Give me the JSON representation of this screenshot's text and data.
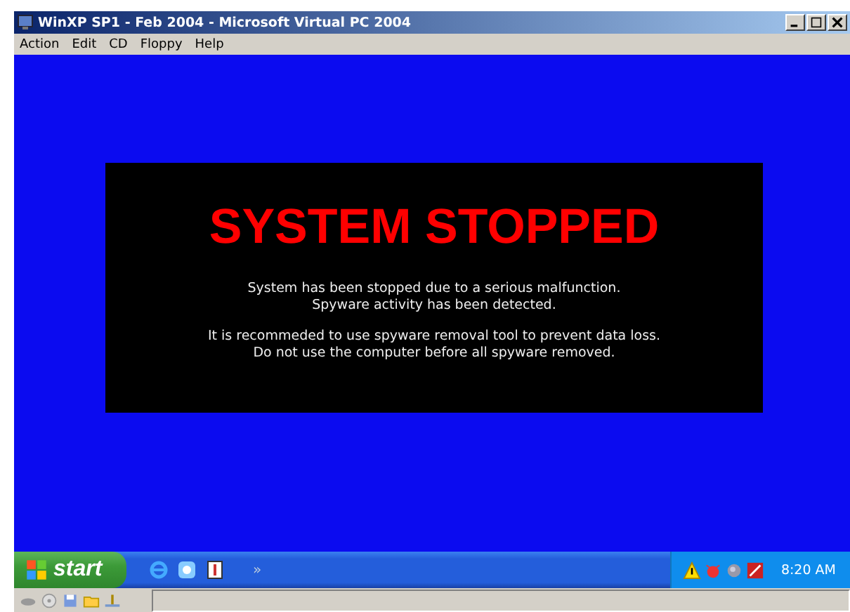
{
  "window": {
    "title": "WinXP SP1 - Feb 2004 - Microsoft Virtual PC 2004"
  },
  "menu": [
    "Action",
    "Edit",
    "CD",
    "Floppy",
    "Help"
  ],
  "alert": {
    "heading": "SYSTEM STOPPED",
    "paragraphs": [
      [
        "System has been stopped due to a serious malfunction.",
        "Spyware activity has been detected."
      ],
      [
        "It is recommeded to use spyware removal tool to prevent data loss.",
        "Do not use the computer before all spyware removed."
      ]
    ]
  },
  "taskbar": {
    "start": "start",
    "overflow": "»",
    "clock": "8:20 AM"
  }
}
